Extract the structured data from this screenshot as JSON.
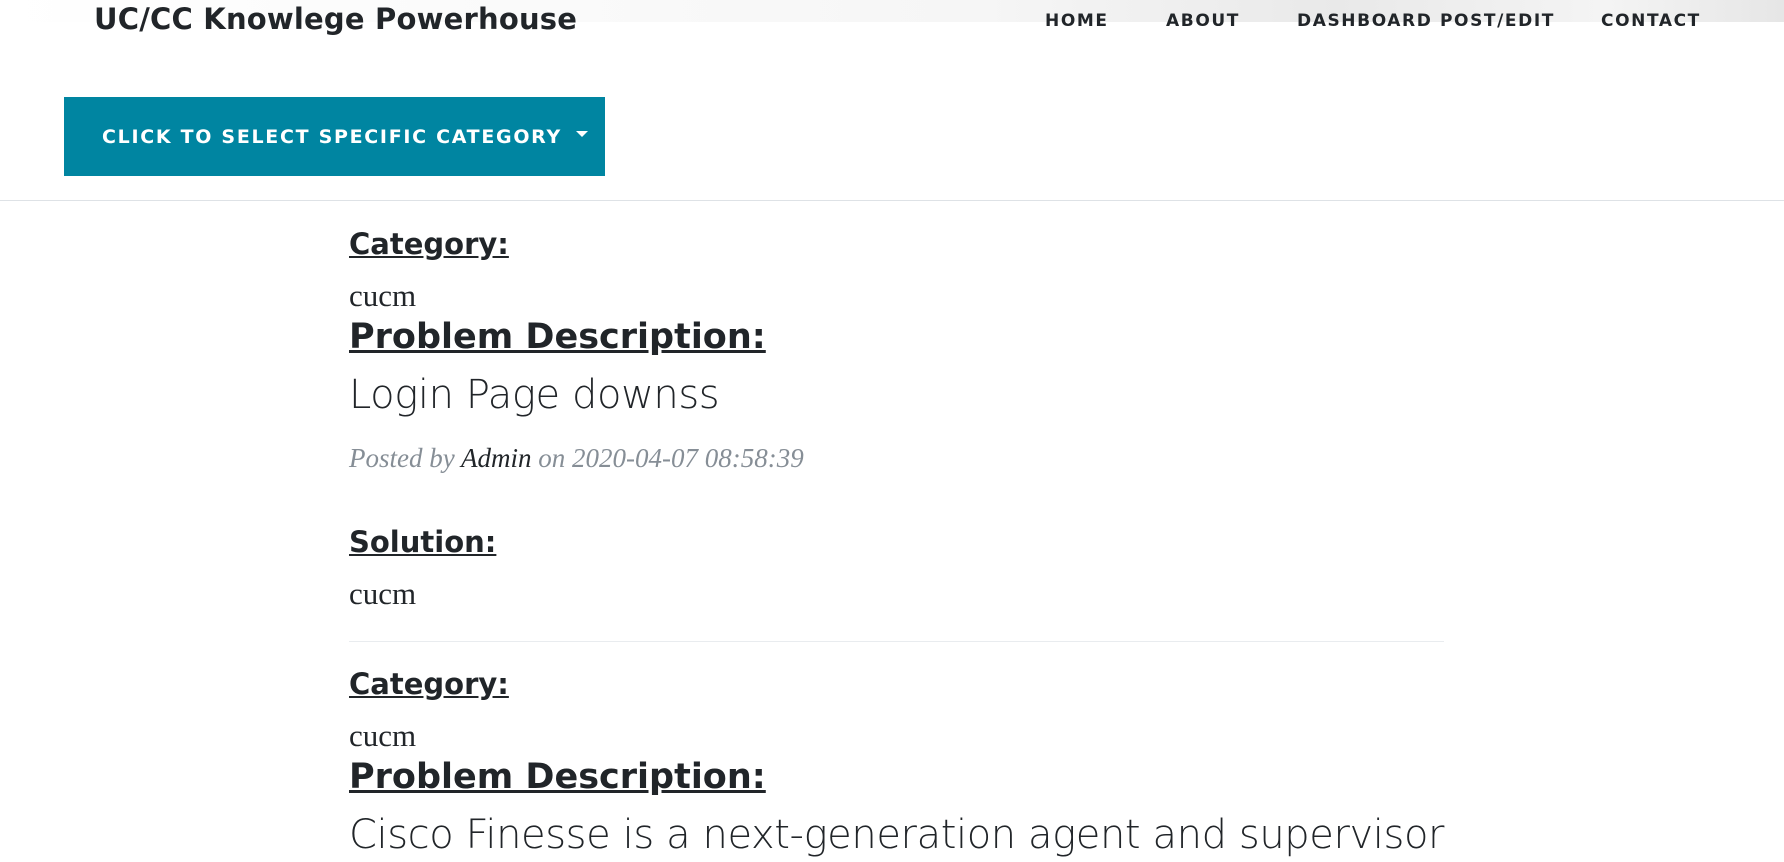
{
  "site": {
    "brand": "UC/CC Knowlege Powerhouse"
  },
  "nav": {
    "home": "HOME",
    "about": "ABOUT",
    "dashboard": "DASHBOARD POST/EDIT",
    "contact": "CONTACT"
  },
  "category_select": {
    "label": "CLICK TO SELECT SPECIFIC CATEGORY"
  },
  "labels": {
    "category": "Category:",
    "problem": "Problem Description:",
    "solution": "Solution:",
    "posted_by": "Posted by",
    "on": "on"
  },
  "posts": [
    {
      "category": "cucm",
      "description": "Login Page downss",
      "author": "Admin",
      "date": "2020-04-07 08:58:39",
      "solution": "cucm"
    },
    {
      "category": "cucm",
      "description": "Cisco Finesse is a next-generation agent and supervisor"
    }
  ],
  "colors": {
    "accent": "#0085a1",
    "text": "#212529",
    "muted": "#868e96"
  }
}
